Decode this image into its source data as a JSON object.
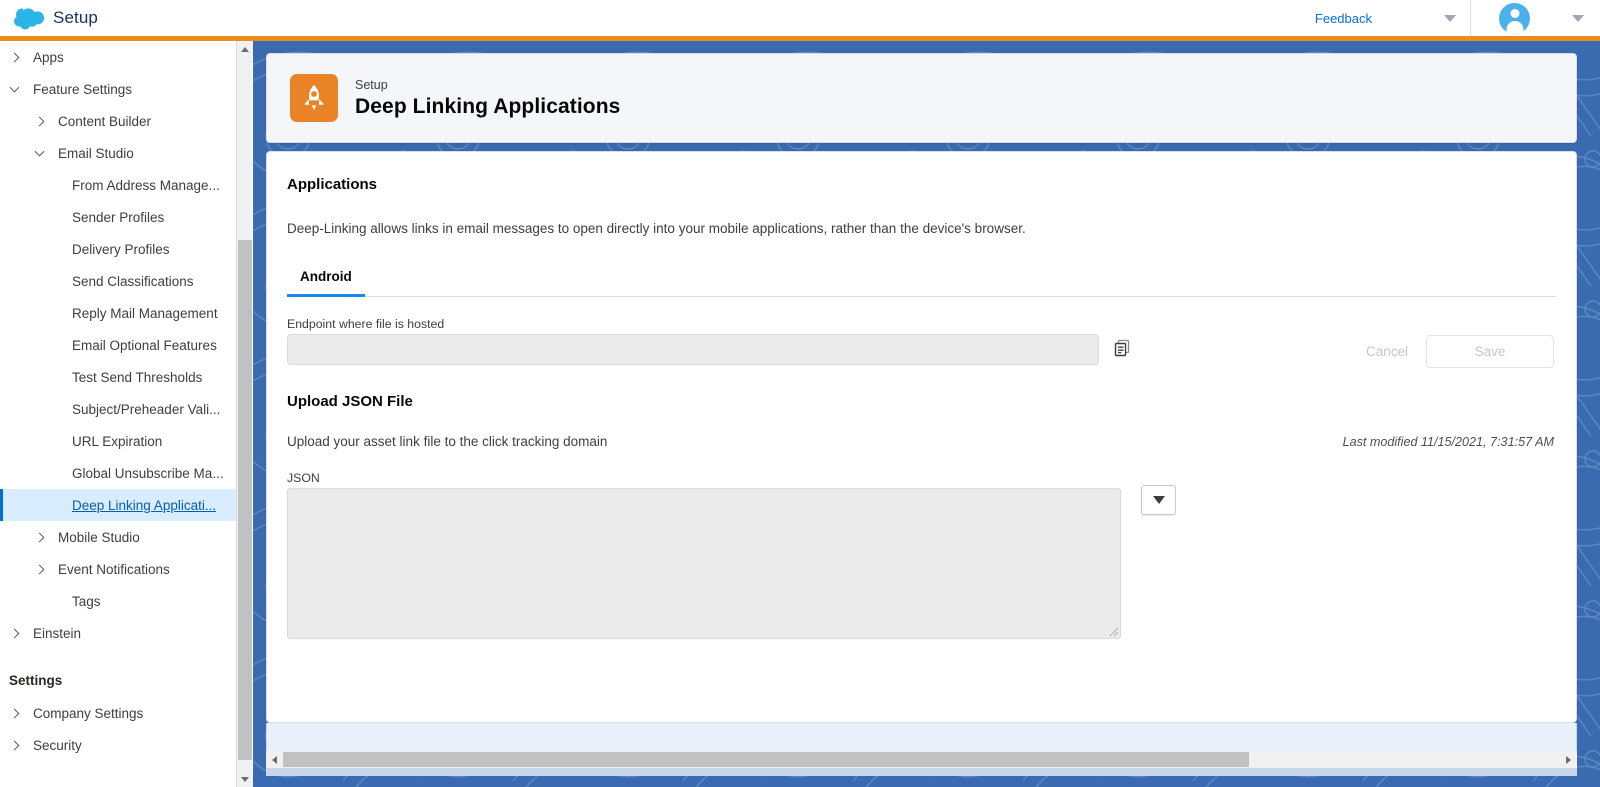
{
  "global_header": {
    "logo_icon": "salesforce-cloud-icon",
    "title": "Setup",
    "feedback_label": "Feedback",
    "feedback_caret_icon": "chevron-down-icon",
    "avatar_icon": "user-avatar-icon",
    "avatar_caret_icon": "chevron-down-icon",
    "accent_rule_color": "#ec8c1c"
  },
  "sidebar": {
    "items": [
      {
        "label": "Apps",
        "level": 1,
        "twisty": "right",
        "selected": false
      },
      {
        "label": "Feature Settings",
        "level": 1,
        "twisty": "down",
        "selected": false
      },
      {
        "label": "Content Builder",
        "level": 2,
        "twisty": "right",
        "selected": false
      },
      {
        "label": "Email Studio",
        "level": 2,
        "twisty": "down",
        "selected": false
      },
      {
        "label": "From Address Manage...",
        "level": 3,
        "twisty": "none",
        "selected": false
      },
      {
        "label": "Sender Profiles",
        "level": 3,
        "twisty": "none",
        "selected": false
      },
      {
        "label": "Delivery Profiles",
        "level": 3,
        "twisty": "none",
        "selected": false
      },
      {
        "label": "Send Classifications",
        "level": 3,
        "twisty": "none",
        "selected": false
      },
      {
        "label": "Reply Mail Management",
        "level": 3,
        "twisty": "none",
        "selected": false
      },
      {
        "label": "Email Optional Features",
        "level": 3,
        "twisty": "none",
        "selected": false
      },
      {
        "label": "Test Send Thresholds",
        "level": 3,
        "twisty": "none",
        "selected": false
      },
      {
        "label": "Subject/Preheader Vali...",
        "level": 3,
        "twisty": "none",
        "selected": false
      },
      {
        "label": "URL Expiration",
        "level": 3,
        "twisty": "none",
        "selected": false
      },
      {
        "label": "Global Unsubscribe Ma...",
        "level": 3,
        "twisty": "none",
        "selected": false
      },
      {
        "label": "Deep Linking Applicati...",
        "level": 3,
        "twisty": "none",
        "selected": true
      },
      {
        "label": "Mobile Studio",
        "level": 2,
        "twisty": "right",
        "selected": false
      },
      {
        "label": "Event Notifications",
        "level": 2,
        "twisty": "right",
        "selected": false
      },
      {
        "label": "Tags",
        "level": 3,
        "twisty": "none",
        "selected": false
      },
      {
        "label": "Einstein",
        "level": 1,
        "twisty": "right",
        "selected": false
      }
    ],
    "section_title": "Settings",
    "settings_items": [
      {
        "label": "Company Settings",
        "level": 1,
        "twisty": "right",
        "selected": false
      },
      {
        "label": "Security",
        "level": 1,
        "twisty": "right",
        "selected": false
      }
    ],
    "scroll_up_icon": "scroll-up-arrow-icon",
    "scroll_down_icon": "scroll-down-arrow-icon",
    "selected_accent_color": "#0070d2"
  },
  "page_header": {
    "icon": "rocket-setup-icon",
    "icon_color": "#ea8226",
    "eyebrow": "Setup",
    "title": "Deep Linking Applications"
  },
  "main": {
    "section_title": "Applications",
    "section_desc": "Deep-Linking allows links in email messages to open directly into your mobile applications, rather than the device's browser.",
    "tabs": [
      {
        "label": "Android",
        "active": true
      }
    ],
    "endpoint": {
      "label": "Endpoint where file is hosted",
      "value": "",
      "placeholder": "",
      "copy_icon": "copy-to-clipboard-icon",
      "disabled": true
    },
    "actions": {
      "cancel_label": "Cancel",
      "save_label": "Save",
      "disabled": true
    },
    "upload": {
      "title": "Upload JSON File",
      "desc": "Upload your asset link file to the click tracking domain",
      "last_modified": "Last modified 11/15/2021, 7:31:57 AM",
      "json_label": "JSON",
      "json_value": "",
      "json_placeholder": "",
      "dropdown_icon": "chevron-down-icon",
      "resize_handle_icon": "resize-grip-icon"
    }
  },
  "scrollbars": {
    "h_left_icon": "scroll-left-arrow-icon",
    "h_right_icon": "scroll-right-arrow-icon"
  },
  "colors": {
    "brand_blue": "#0070d2",
    "tab_underline": "#1589ee",
    "pane_background": "#3a6bb0",
    "orange_accent": "#ec8c1c"
  }
}
